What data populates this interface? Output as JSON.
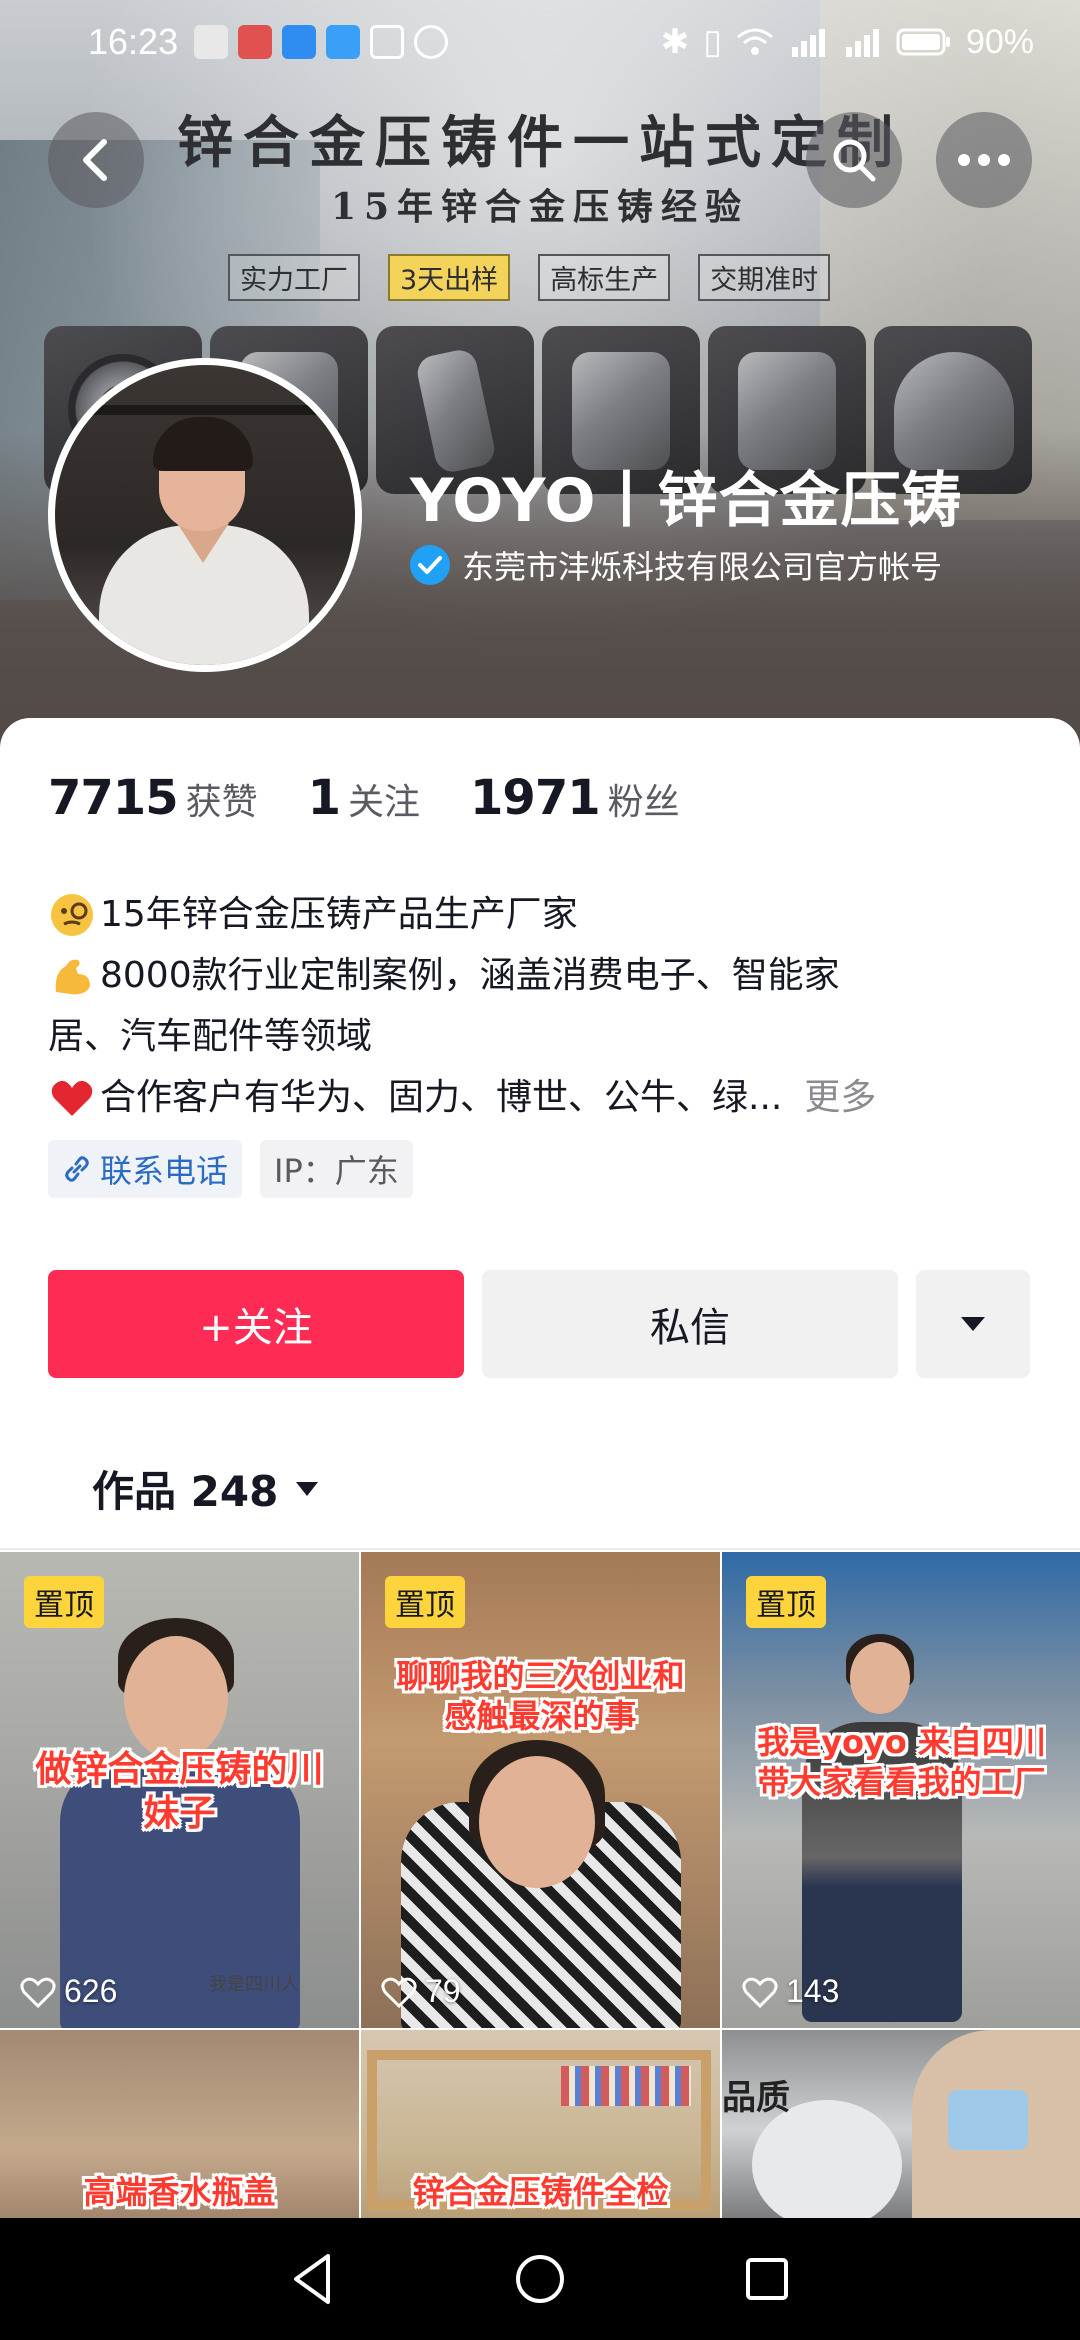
{
  "status_bar": {
    "time": "16:23",
    "battery": "90%",
    "notification_icons": [
      "mail-icon",
      "app-icon",
      "weather-icon",
      "browser-icon",
      "nfc-icon",
      "alarm-icon"
    ],
    "status_icons": [
      "bluetooth-icon",
      "vibrate-icon",
      "wifi-icon",
      "signal-4g-icon",
      "signal-4g-icon",
      "battery-icon"
    ]
  },
  "banner": {
    "title": "锌合金压铸件一站式定制",
    "subtitle": "15年锌合金压铸经验",
    "tags": [
      "实力工厂",
      "3天出样",
      "高标生产",
      "交期准时"
    ],
    "highlight_tag_index": 1
  },
  "top_actions": {
    "back_icon": "chevron-left-icon",
    "search_icon": "search-icon",
    "more_icon": "more-horizontal-icon"
  },
  "profile": {
    "name": "YOYO丨锌合金压铸",
    "verified_text": "东莞市沣烁科技有限公司官方帐号",
    "verified_icon": "verified-check-icon"
  },
  "stats": [
    {
      "value": "7715",
      "label": "获赞"
    },
    {
      "value": "1",
      "label": "关注"
    },
    {
      "value": "1971",
      "label": "粉丝"
    }
  ],
  "bio": {
    "line1": "15年锌合金压铸产品生产厂家",
    "line2": "8000款行业定制案例，涵盖消费电子、智能家",
    "line2_cont": "居、汽车配件等领域",
    "line3": "合作客户有华为、固力、博世、公牛、绿...",
    "more": "更多",
    "emojis": [
      "monocle-face-emoji",
      "flexed-biceps-emoji",
      "red-heart-emoji"
    ]
  },
  "chips": {
    "contact": "联系电话",
    "ip": "IP：广东"
  },
  "buttons": {
    "follow": "+关注",
    "message": "私信",
    "dropdown_icon": "caret-down-icon"
  },
  "works_tab": {
    "label": "作品 248"
  },
  "videos": [
    {
      "pinned": "置顶",
      "caption": "做锌合金压铸的川妹子",
      "likes": "626",
      "watermark": "我是四川人"
    },
    {
      "pinned": "置顶",
      "caption": "聊聊我的三次创业和感触最深的事",
      "likes": "79"
    },
    {
      "pinned": "置顶",
      "caption": "我是yoyo 来自四川带大家看看我的工厂",
      "likes": "143"
    },
    {
      "caption": "高端香水瓶盖"
    },
    {
      "caption": "锌合金压铸件全检"
    },
    {
      "caption": "品质"
    }
  ],
  "colors": {
    "accent": "#fe2c55",
    "verified": "#20a1f6",
    "link": "#2a6cc4",
    "pin": "#fdd43b",
    "caption": "#ff3b30"
  },
  "navbar": {
    "icons": [
      "back-triangle-icon",
      "home-circle-icon",
      "recents-square-icon"
    ]
  }
}
